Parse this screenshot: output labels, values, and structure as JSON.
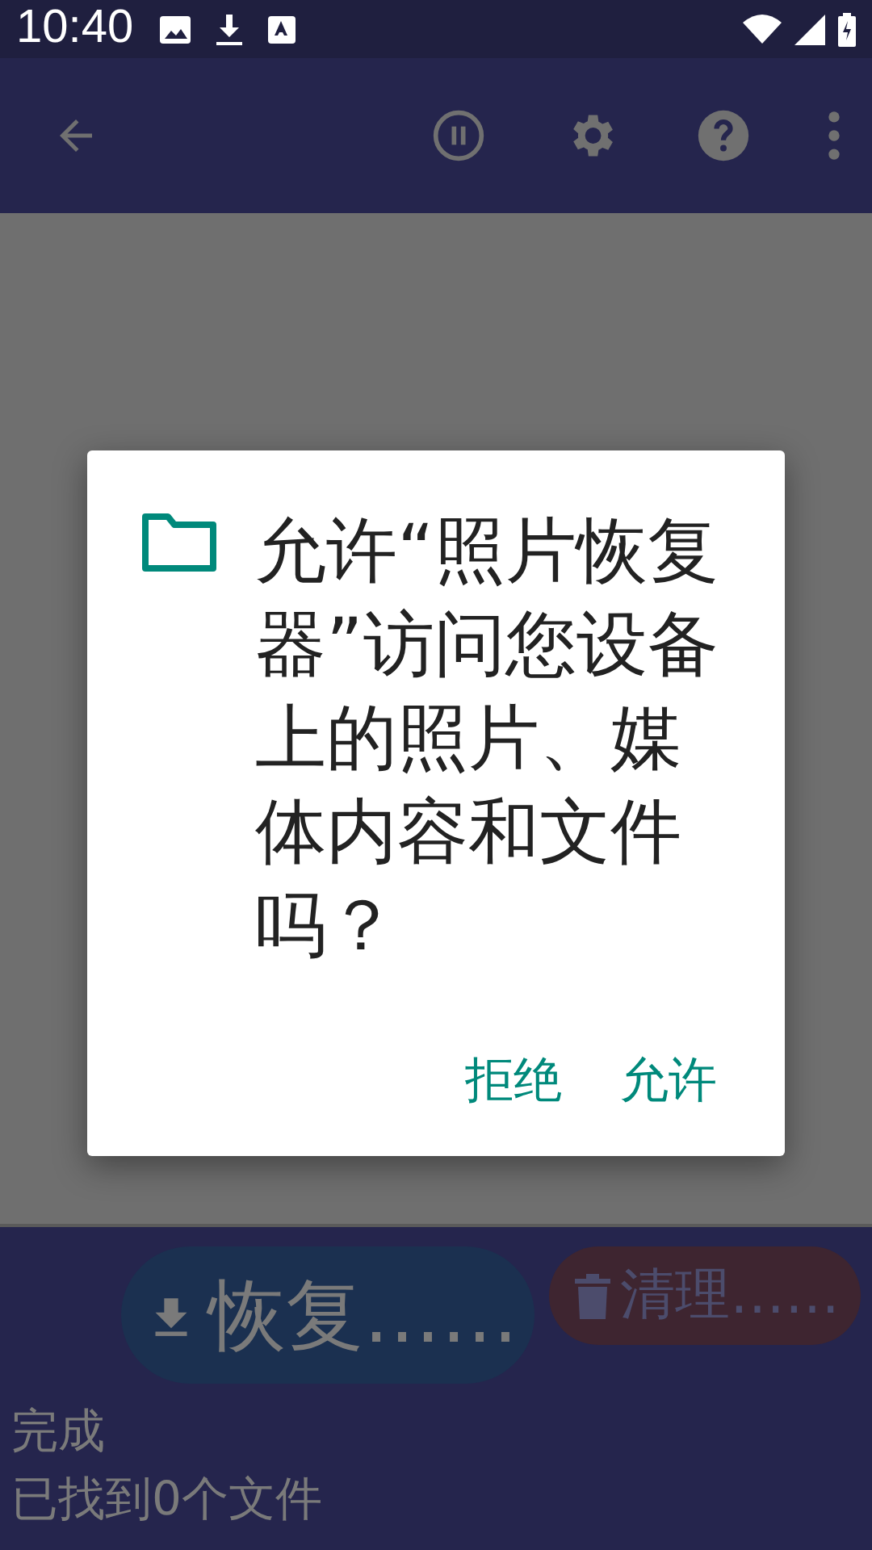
{
  "status_bar": {
    "time": "10:40"
  },
  "toolbar": {
    "actions": [
      {
        "kind": "pause"
      },
      {
        "kind": "settings"
      },
      {
        "kind": "help"
      },
      {
        "kind": "more"
      }
    ]
  },
  "dialog": {
    "message": "允许“照片恢复器”访问您设备上的照片、媒体内容和文件吗？",
    "buttons": [
      "拒绝",
      "允许"
    ]
  },
  "actions": [
    {
      "kind": "restore",
      "label": "恢复……",
      "disabled": false
    },
    {
      "kind": "clean",
      "label": "清理……",
      "disabled": true
    }
  ],
  "status_lines": [
    "完成",
    "已找到0个文件"
  ]
}
